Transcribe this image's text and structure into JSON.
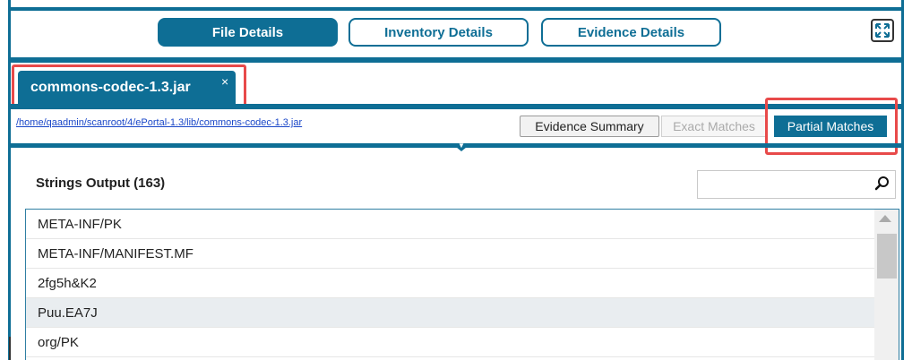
{
  "tabs": {
    "file_details": "File Details",
    "inventory_details": "Inventory Details",
    "evidence_details": "Evidence Details"
  },
  "file_tab": {
    "label": "commons-codec-1.3.jar",
    "close": "×"
  },
  "path": {
    "link": "/home/qaadmin/scanroot/4/ePortal-1.3/lib/commons-codec-1.3.jar"
  },
  "view_buttons": {
    "evidence_summary": "Evidence Summary",
    "exact_matches": "Exact Matches",
    "partial_matches": "Partial Matches"
  },
  "strings": {
    "title": "Strings Output (163)",
    "search_placeholder": "",
    "rows": [
      "META-INF/PK",
      "META-INF/MANIFEST.MF",
      "2fg5h&K2",
      "Puu.EA7J",
      "org/PK"
    ],
    "selected_index": 3
  },
  "icons": {
    "expand": "expand-icon",
    "search": "search-icon",
    "close": "close-icon"
  },
  "colors": {
    "accent": "#0e6e95",
    "highlight": "#e84a4a",
    "link": "#1a47c8"
  }
}
